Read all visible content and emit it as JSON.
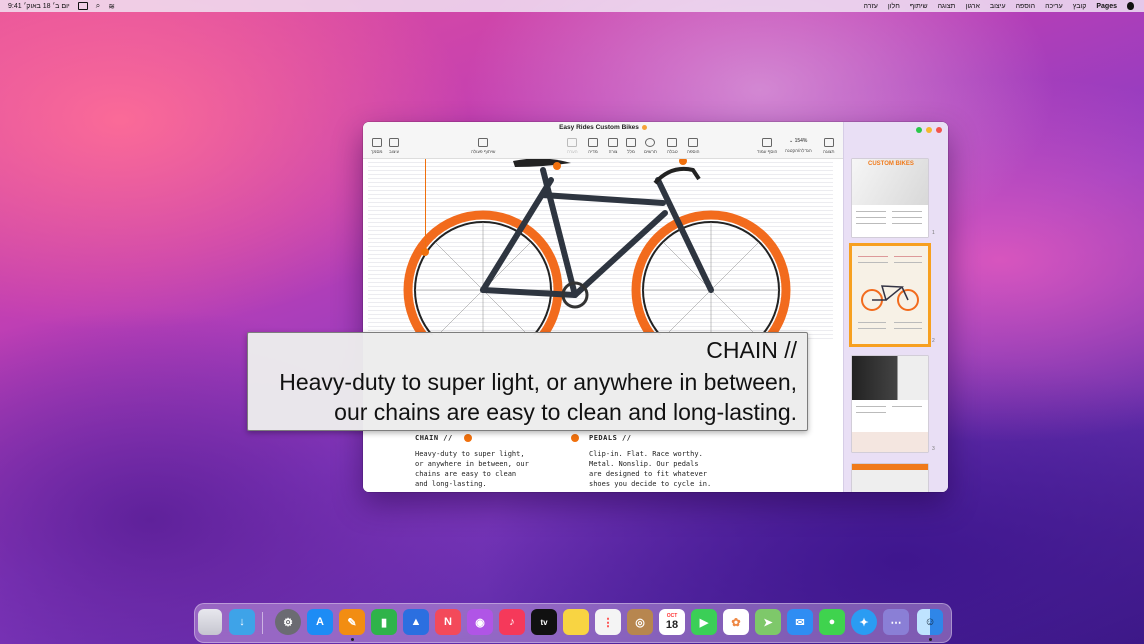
{
  "menubar": {
    "app_name": "Pages",
    "menus": [
      "קובץ",
      "עריכה",
      "הוספה",
      "עיצוב",
      "ארגון",
      "תצוגה",
      "שיתוף",
      "חלון",
      "עזרה"
    ],
    "clock": "יום ב׳ 18 באוק׳ 9:41"
  },
  "window": {
    "title": "Easy Rides Custom Bikes",
    "toolbar": {
      "view": "תצוגה",
      "zoom_value": "154%",
      "zoom_label": "הגדלה/הקטנה",
      "add_page": "הוסף עמוד",
      "insert": "הוספה",
      "table": "טבלה",
      "chart": "תרשים",
      "text": "מלל",
      "shape": "צורה",
      "media": "מדיה",
      "comment": "הערה",
      "collaborate": "שיתוף פעולה",
      "format": "עיצוב",
      "document": "מסמך"
    }
  },
  "document": {
    "chain_heading": "CHAIN //",
    "chain_body": "Heavy-duty to super light,\nor anywhere in between, our\nchains are easy to clean\nand long-lasting.",
    "pedals_heading": "PEDALS //",
    "pedals_body": "Clip-in. Flat. Race worthy.\nMetal. Nonslip. Our pedals\nare designed to fit whatever\nshoes you decide to cycle in."
  },
  "sidebar": {
    "page_numbers": [
      "1",
      "2",
      "3"
    ],
    "thumb1_title": "CUSTOM BIKES"
  },
  "caption": {
    "line1": "CHAIN //",
    "line2": "Heavy-duty to super light, or anywhere in between,",
    "line3": "our chains are easy to clean and long-lasting."
  },
  "dock": {
    "calendar_month": "OCT",
    "calendar_day": "18",
    "tv_label": "tv"
  },
  "colors": {
    "accent_orange": "#f0700d",
    "selection": "#f7a020"
  }
}
